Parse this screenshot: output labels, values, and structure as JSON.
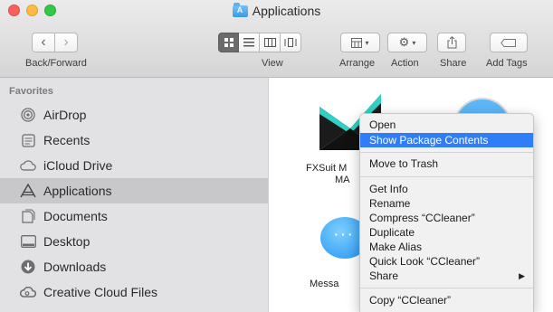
{
  "window": {
    "title": "Applications"
  },
  "toolbar": {
    "back_forward_label": "Back/Forward",
    "view_label": "View",
    "arrange_label": "Arrange",
    "action_label": "Action",
    "share_label": "Share",
    "add_tags_label": "Add Tags",
    "view_modes": [
      "icon",
      "list",
      "column",
      "cover-flow"
    ],
    "active_view": "icon"
  },
  "sidebar": {
    "heading": "Favorites",
    "items": [
      {
        "label": "AirDrop",
        "icon": "airdrop-icon"
      },
      {
        "label": "Recents",
        "icon": "recents-icon"
      },
      {
        "label": "iCloud Drive",
        "icon": "cloud-icon"
      },
      {
        "label": "Applications",
        "icon": "applications-icon",
        "selected": true
      },
      {
        "label": "Documents",
        "icon": "documents-icon"
      },
      {
        "label": "Desktop",
        "icon": "desktop-icon"
      },
      {
        "label": "Downloads",
        "icon": "downloads-icon"
      },
      {
        "label": "Creative Cloud Files",
        "icon": "creative-cloud-icon"
      }
    ]
  },
  "content": {
    "apps": [
      {
        "label_line1": "FXSuit M",
        "label_line2": "MA",
        "icon": "fxsuit-icon"
      },
      {
        "label_line1": "",
        "icon": "safari-icon"
      },
      {
        "label_line1": "Messa",
        "icon": "messages-icon"
      }
    ]
  },
  "context_menu": {
    "items": [
      {
        "label": "Open"
      },
      {
        "label": "Show Package Contents",
        "highlighted": true
      },
      {
        "label": "Move to Trash"
      },
      {
        "label": "Get Info"
      },
      {
        "label": "Rename"
      },
      {
        "label": "Compress “CCleaner”"
      },
      {
        "label": "Duplicate"
      },
      {
        "label": "Make Alias"
      },
      {
        "label": "Quick Look “CCleaner”"
      },
      {
        "label": "Share",
        "submenu": true
      },
      {
        "label": "Copy “CCleaner”"
      }
    ]
  },
  "colors": {
    "highlight": "#2f7ef8",
    "sidebar_bg": "#e2e2e4",
    "sidebar_selected": "#c8c8cb",
    "close": "#fc605c",
    "minimize": "#fdbc40",
    "zoom": "#34c84a"
  }
}
